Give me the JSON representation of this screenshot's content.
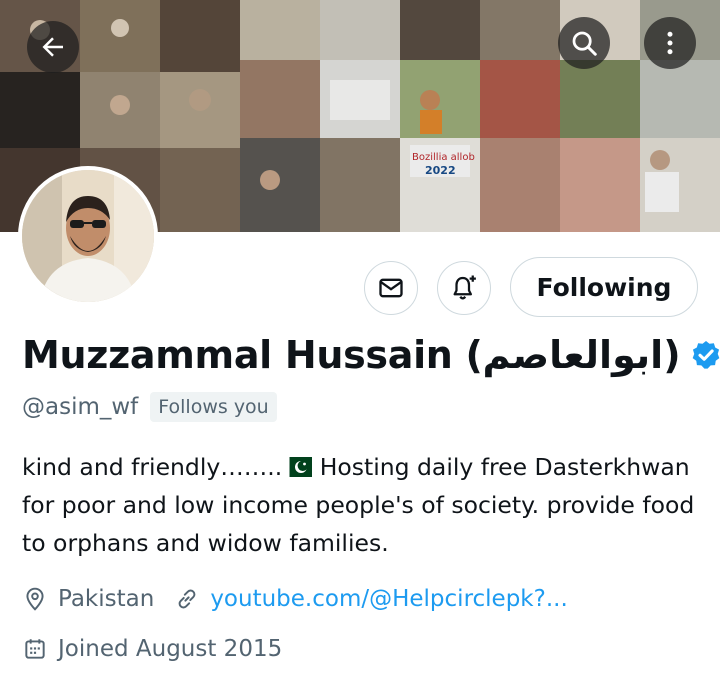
{
  "header": {
    "back_icon": "arrow-left-icon",
    "search_icon": "search-icon",
    "more_icon": "more-vertical-icon",
    "banner_text_1": "Bozillia allob",
    "banner_text_2": "2022"
  },
  "profile": {
    "name": "Muzzammal Hussain (ابوالعاصم)",
    "verified_icon": "verified-badge-icon",
    "handle": "@asim_wf",
    "follows_you": "Follows you",
    "bio_part1": "kind and friendly……..",
    "bio_flag": "pakistan-flag-icon",
    "bio_part2": " Hosting daily free Dasterkhwan for poor and low income people's of society. provide food to orphans and widow families.",
    "location": "Pakistan",
    "website": "youtube.com/@Helpcirclepk?...",
    "joined": "Joined August 2015"
  },
  "actions": {
    "message_icon": "envelope-icon",
    "notify_icon": "bell-plus-icon",
    "following_label": "Following"
  },
  "colors": {
    "accent": "#1d9bf0",
    "secondary_text": "#536471",
    "border": "#cfd9de"
  }
}
